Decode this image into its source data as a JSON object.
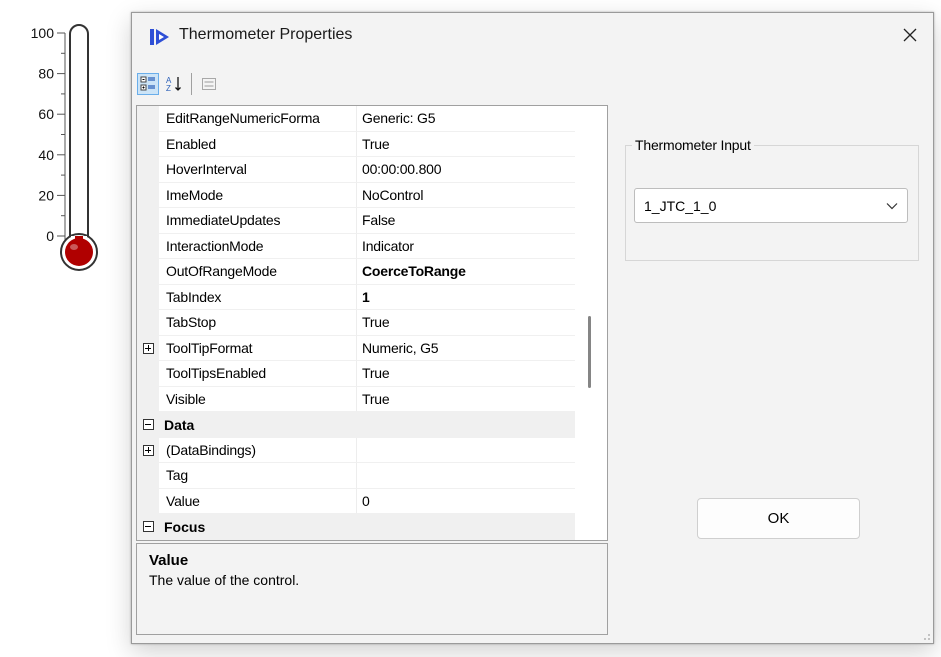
{
  "thermometer": {
    "ticks": [
      "100",
      "80",
      "60",
      "40",
      "20",
      "0"
    ],
    "value": 0,
    "fill_color": "#b00000"
  },
  "dialog": {
    "title": "Thermometer Properties",
    "close_glyph": "✕"
  },
  "toolbar": {
    "icons": [
      "categorized-icon",
      "alphabetical-sort-icon",
      "property-pages-icon"
    ]
  },
  "property_grid": {
    "rows": [
      {
        "type": "prop",
        "name": "EditRangeNumericForma",
        "value": "Generic: G5",
        "bold": false
      },
      {
        "type": "prop",
        "name": "Enabled",
        "value": "True",
        "bold": false
      },
      {
        "type": "prop",
        "name": "HoverInterval",
        "value": "00:00:00.800",
        "bold": false
      },
      {
        "type": "prop",
        "name": "ImeMode",
        "value": "NoControl",
        "bold": false
      },
      {
        "type": "prop",
        "name": "ImmediateUpdates",
        "value": "False",
        "bold": false
      },
      {
        "type": "prop",
        "name": "InteractionMode",
        "value": "Indicator",
        "bold": false
      },
      {
        "type": "prop",
        "name": "OutOfRangeMode",
        "value": "CoerceToRange",
        "bold": true
      },
      {
        "type": "prop",
        "name": "TabIndex",
        "value": "1",
        "bold": true
      },
      {
        "type": "prop",
        "name": "TabStop",
        "value": "True",
        "bold": false
      },
      {
        "type": "prop",
        "name": "ToolTipFormat",
        "value": "Numeric, G5",
        "bold": false,
        "expander": "plus"
      },
      {
        "type": "prop",
        "name": "ToolTipsEnabled",
        "value": "True",
        "bold": false
      },
      {
        "type": "prop",
        "name": "Visible",
        "value": "True",
        "bold": false
      },
      {
        "type": "cat",
        "name": "Data",
        "expander": "minus"
      },
      {
        "type": "prop",
        "name": "(DataBindings)",
        "value": "",
        "bold": false,
        "expander": "plus"
      },
      {
        "type": "prop",
        "name": "Tag",
        "value": "",
        "bold": false
      },
      {
        "type": "prop",
        "name": "Value",
        "value": "0",
        "bold": false
      },
      {
        "type": "cat",
        "name": "Focus",
        "expander": "minus"
      }
    ]
  },
  "description": {
    "title": "Value",
    "text": "The value of the control."
  },
  "input_group": {
    "legend": "Thermometer Input",
    "selected": "1_JTC_1_0"
  },
  "ok_button": {
    "label": "OK"
  }
}
